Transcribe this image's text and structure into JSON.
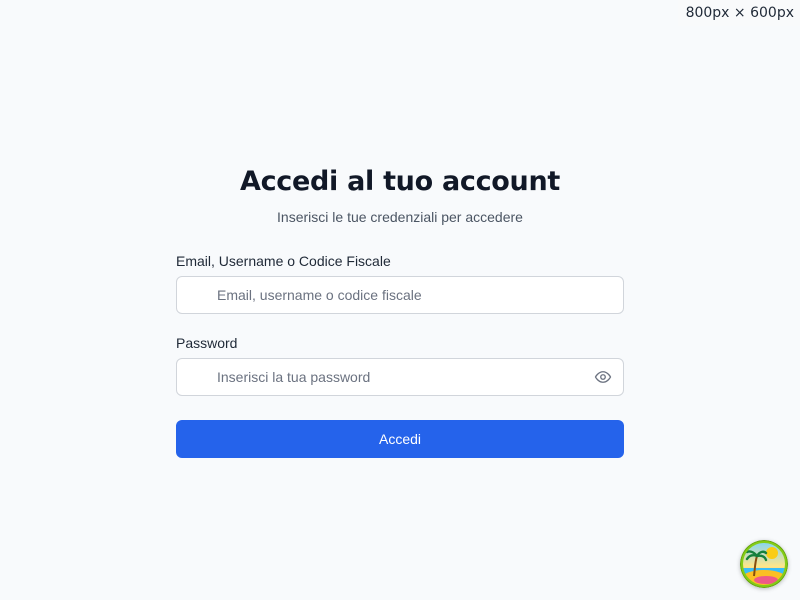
{
  "viewport_label": "800px × 600px",
  "login": {
    "title": "Accedi al tuo account",
    "subtitle": "Inserisci le tue credenziali per accedere",
    "identifier": {
      "label": "Email, Username o Codice Fiscale",
      "placeholder": "Email, username o codice fiscale",
      "value": ""
    },
    "password": {
      "label": "Password",
      "placeholder": "Inserisci la tua password",
      "value": ""
    },
    "submit_label": "Accedi"
  },
  "icons": {
    "password_toggle": "eye-icon",
    "corner_widget": "beach-sunset-avatar-icon"
  },
  "colors": {
    "background": "#f8fafc",
    "primary": "#2563eb",
    "title": "#111827",
    "muted_text": "#4b5563",
    "input_border": "#d1d5db"
  }
}
